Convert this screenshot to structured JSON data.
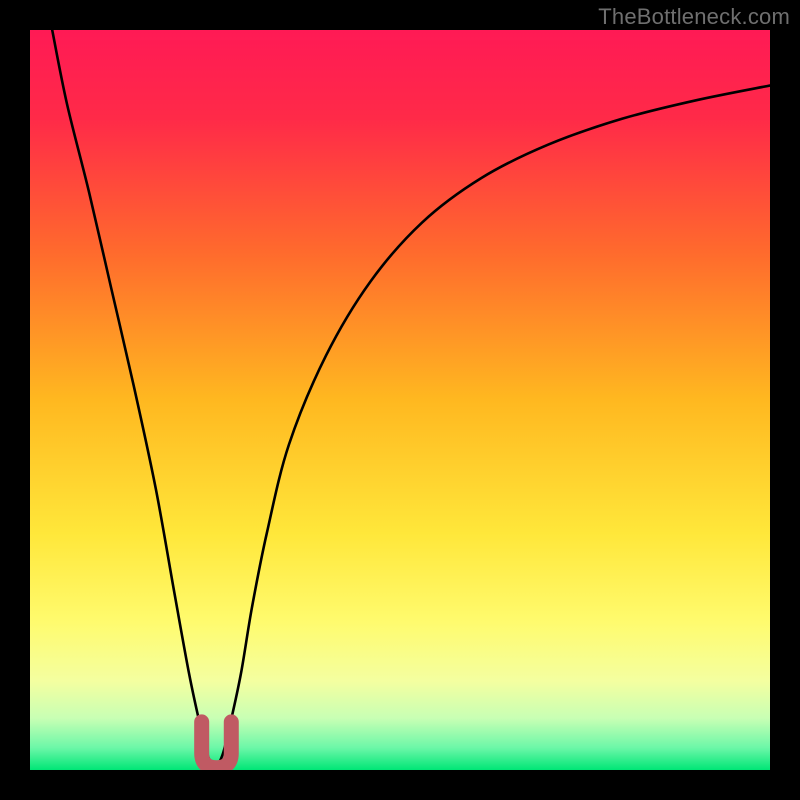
{
  "watermark": "TheBottleneck.com",
  "colors": {
    "frame": "#000000",
    "gradient_stops": [
      {
        "offset": 0.0,
        "color": "#ff1a55"
      },
      {
        "offset": 0.12,
        "color": "#ff2a48"
      },
      {
        "offset": 0.3,
        "color": "#ff6a2d"
      },
      {
        "offset": 0.5,
        "color": "#ffb820"
      },
      {
        "offset": 0.68,
        "color": "#ffe73a"
      },
      {
        "offset": 0.8,
        "color": "#fffb6e"
      },
      {
        "offset": 0.88,
        "color": "#f4ffa0"
      },
      {
        "offset": 0.93,
        "color": "#c8ffb4"
      },
      {
        "offset": 0.97,
        "color": "#6cf7a8"
      },
      {
        "offset": 1.0,
        "color": "#00e676"
      }
    ],
    "curve": "#000000",
    "marker_fill": "#cc6a72",
    "marker_stroke": "#c05a63"
  },
  "chart_data": {
    "type": "line",
    "title": "",
    "xlabel": "",
    "ylabel": "",
    "xlim": [
      0,
      100
    ],
    "ylim": [
      0,
      100
    ],
    "grid": false,
    "legend": false,
    "series": [
      {
        "name": "bottleneck-curve",
        "x": [
          3,
          5,
          8,
          11,
          14,
          17,
          19.5,
          21.5,
          23,
          24,
          25,
          26,
          27,
          28.5,
          30,
          32,
          35,
          40,
          46,
          53,
          61,
          70,
          80,
          90,
          100
        ],
        "y": [
          100,
          90,
          78,
          65,
          52,
          38,
          24,
          13,
          6,
          2,
          0.5,
          2,
          6,
          13,
          22,
          32,
          44,
          56,
          66,
          74,
          80,
          84.5,
          88,
          90.5,
          92.5
        ]
      }
    ],
    "markers": [
      {
        "name": "min-region-u-shape",
        "x_range": [
          23.2,
          27.2
        ],
        "y_range": [
          0.3,
          6.5
        ],
        "shape": "u"
      }
    ],
    "annotations": [
      {
        "text": "TheBottleneck.com",
        "role": "watermark",
        "position": "top-right"
      }
    ]
  }
}
